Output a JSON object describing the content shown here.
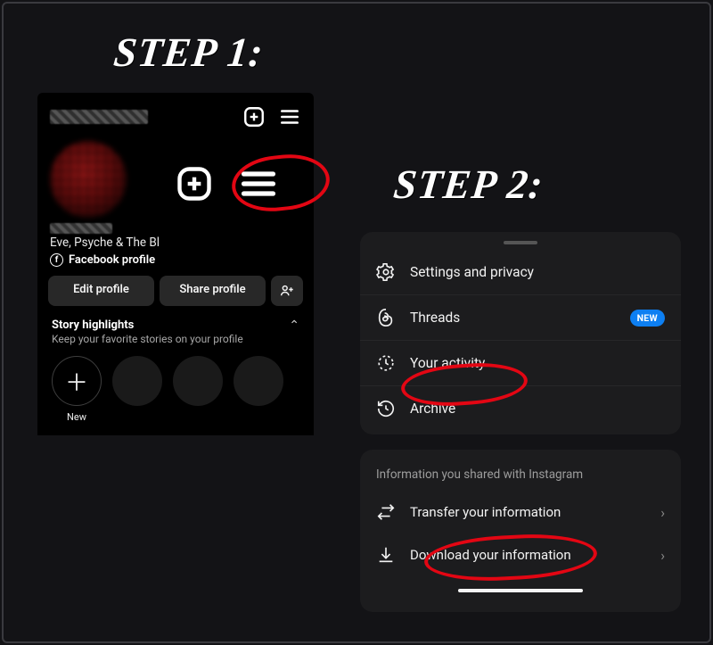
{
  "steps": {
    "one": "STEP 1:",
    "two": "STEP 2:"
  },
  "profile": {
    "bio": "Eve, Psyche & The Bl",
    "fb_link": "Facebook profile",
    "edit_btn": "Edit profile",
    "share_btn": "Share profile",
    "highlights_title": "Story highlights",
    "highlights_sub": "Keep your favorite stories on your profile",
    "add_new": "New"
  },
  "menu": {
    "settings": "Settings and privacy",
    "threads": "Threads",
    "threads_badge": "NEW",
    "activity": "Your activity",
    "archive": "Archive"
  },
  "info": {
    "header": "Information you shared with Instagram",
    "transfer": "Transfer your information",
    "download": "Download your information"
  },
  "icons": {
    "add": "add-post-icon",
    "menu": "hamburger-menu-icon",
    "discover": "discover-people-icon",
    "gear": "gear-icon",
    "threads": "threads-icon",
    "clock": "activity-clock-icon",
    "archive": "archive-icon",
    "transfer": "transfer-icon",
    "download": "download-icon"
  }
}
